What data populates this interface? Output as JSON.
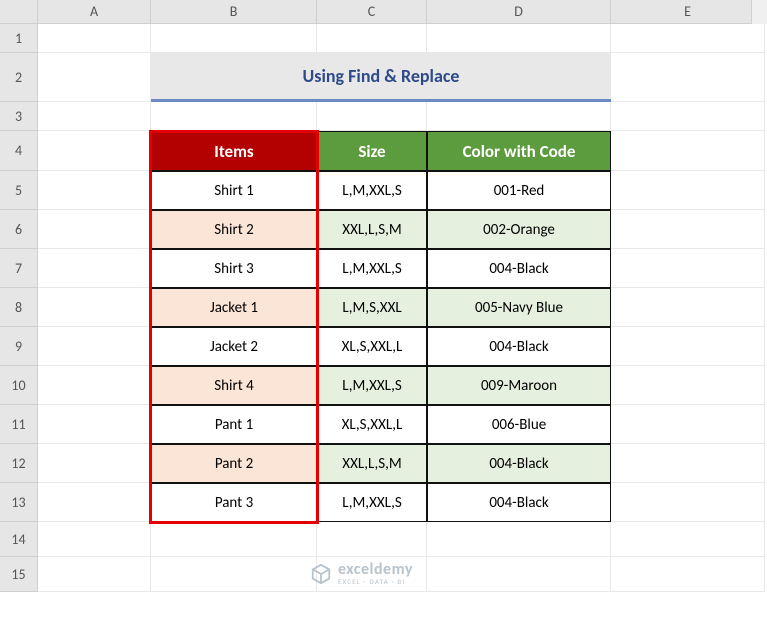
{
  "columns": [
    "A",
    "B",
    "C",
    "D",
    "E"
  ],
  "rows": [
    "1",
    "2",
    "3",
    "4",
    "5",
    "6",
    "7",
    "8",
    "9",
    "10",
    "11",
    "12",
    "13",
    "14",
    "15"
  ],
  "title": "Using Find & Replace",
  "headers": {
    "items": "Items",
    "size": "Size",
    "color": "Color with Code"
  },
  "data": [
    {
      "item": "Shirt 1",
      "size": "L,M,XXL,S",
      "color": "001-Red"
    },
    {
      "item": "Shirt 2",
      "size": "XXL,L,S,M",
      "color": "002-Orange"
    },
    {
      "item": "Shirt 3",
      "size": "L,M,XXL,S",
      "color": "004-Black"
    },
    {
      "item": "Jacket 1",
      "size": "L,M,S,XXL",
      "color": "005-Navy Blue"
    },
    {
      "item": "Jacket 2",
      "size": "XL,S,XXL,L",
      "color": "004-Black"
    },
    {
      "item": "Shirt 4",
      "size": "L,M,XXL,S",
      "color": "009-Maroon"
    },
    {
      "item": "Pant 1",
      "size": "XL,S,XXL,L",
      "color": "006-Blue"
    },
    {
      "item": "Pant 2",
      "size": "XXL,L,S,M",
      "color": "004-Black"
    },
    {
      "item": "Pant 3",
      "size": "L,M,XXL,S",
      "color": "004-Black"
    }
  ],
  "watermark": {
    "main": "exceldemy",
    "sub": "EXCEL · DATA · BI"
  }
}
